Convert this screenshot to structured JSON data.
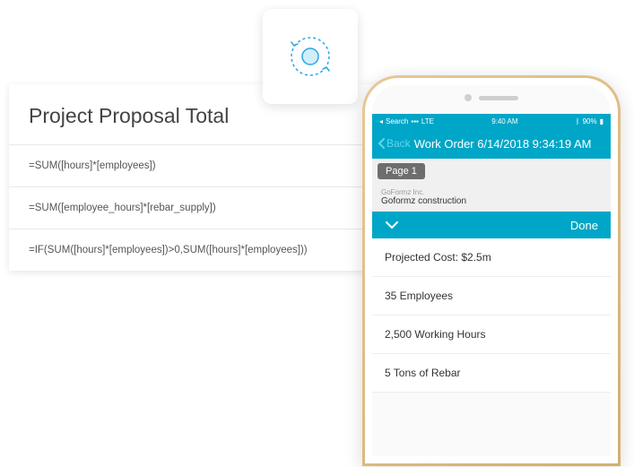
{
  "panel": {
    "title": "Project Proposal Total",
    "formulas": [
      "=SUM([hours]*[employees])",
      "=SUM([employee_hours]*[rebar_supply])",
      "=IF(SUM([hours]*[employees])>0,SUM([hours]*[employees]))"
    ]
  },
  "phone": {
    "status": {
      "search": "Search",
      "signal": "LTE",
      "time": "9:40 AM",
      "battery": "90%"
    },
    "header": {
      "back": "Back",
      "title": "Work Order 6/14/2018 9:34:19 AM"
    },
    "page_tab": "Page 1",
    "company": {
      "label": "GoFormz Inc.",
      "name": "Goformz construction"
    },
    "done": "Done",
    "items": [
      "Projected Cost: $2.5m",
      "35 Employees",
      "2,500 Working Hours",
      "5 Tons of Rebar"
    ]
  }
}
